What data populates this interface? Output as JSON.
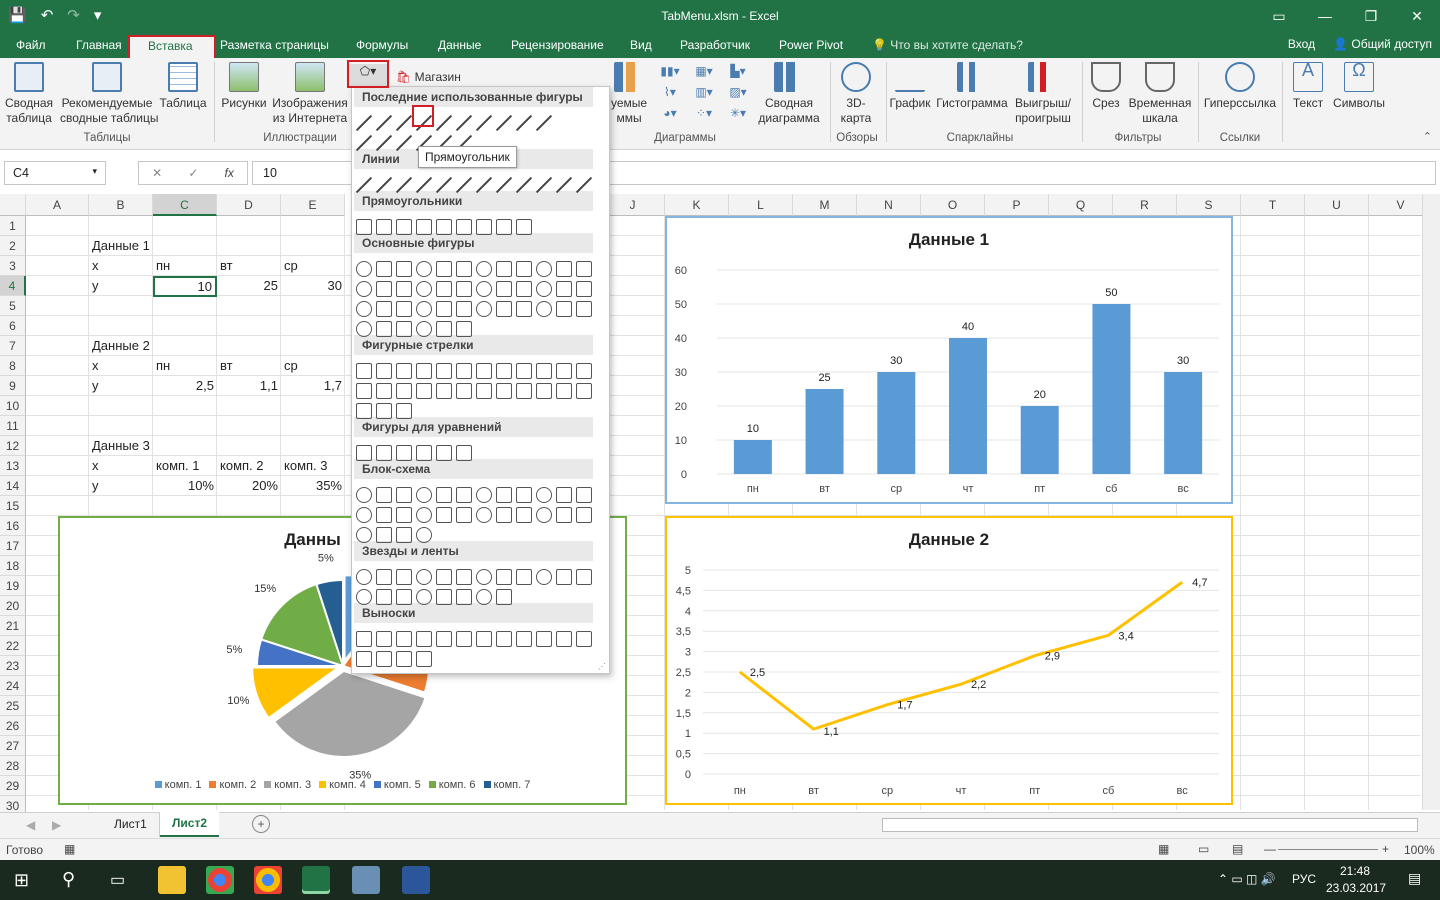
{
  "window": {
    "title": "TabMenu.xlsm - Excel",
    "controls": [
      "▭",
      "—",
      "❐",
      "✕"
    ]
  },
  "ribbon_tabs": [
    "Файл",
    "Главная",
    "Вставка",
    "Разметка страницы",
    "Формулы",
    "Данные",
    "Рецензирование",
    "Вид",
    "Разработчик",
    "Power Pivot"
  ],
  "active_tab": "Вставка",
  "tellme": "Что вы хотите сделать?",
  "login": "Вход",
  "share": "Общий доступ",
  "ribbon": {
    "pivot": "Сводная\nтаблица",
    "recommended_pivot": "Рекомендуемые\nсводные таблицы",
    "table": "Таблица",
    "pictures": "Рисунки",
    "online_pictures": "Изображения\nиз Интернета",
    "store": "Магазин",
    "recommended_charts_partial": "уемые\nммы",
    "pivot_chart": "Сводная\nдиаграмма",
    "map3d": "3D-\nкарта",
    "graph": "График",
    "histogram": "Гистограмма",
    "winloss": "Выигрыш/\nпроигрыш",
    "slicer": "Срез",
    "timeline": "Временная\nшкала",
    "hyperlink": "Гиперссылка",
    "text": "Текст",
    "symbols": "Символы",
    "groups": {
      "tables": "Таблицы",
      "illustrations": "Иллюстрации",
      "charts": "Диаграммы",
      "tours": "Обзоры",
      "sparklines": "Спарклайны",
      "filters": "Фильтры",
      "links": "Ссылки"
    }
  },
  "formula_bar": {
    "name_box": "C4",
    "value": "10"
  },
  "columns": [
    "A",
    "B",
    "C",
    "D",
    "E",
    "J",
    "K",
    "L",
    "M",
    "N",
    "O",
    "P",
    "Q",
    "R",
    "S",
    "T",
    "U",
    "V"
  ],
  "rows": [
    "1",
    "2",
    "3",
    "4",
    "5",
    "6",
    "7",
    "8",
    "9",
    "10",
    "11",
    "12",
    "13",
    "14",
    "15",
    "16",
    "17",
    "18",
    "19",
    "20",
    "21",
    "22",
    "23",
    "24",
    "25",
    "26",
    "27",
    "28",
    "29",
    "30"
  ],
  "cells": {
    "b2": "Данные 1",
    "b3": "x",
    "c3": "пн",
    "d3": "вт",
    "e3": "ср",
    "b4": "y",
    "c4": "10",
    "d4": "25",
    "e4": "30",
    "b7": "Данные 2",
    "b8": "x",
    "c8": "пн",
    "d8": "вт",
    "e8": "ср",
    "b9": "y",
    "c9": "2,5",
    "d9": "1,1",
    "e9": "1,7",
    "b12": "Данные 3",
    "b13": "x",
    "c13": "комп. 1",
    "d13": "комп. 2",
    "e13": "комп. 3",
    "b14": "y",
    "c14": "10%",
    "d14": "20%",
    "e14": "35%"
  },
  "shapes_menu": {
    "sections": [
      "Последние использованные фигуры",
      "Линии",
      "Прямоугольники",
      "Основные фигуры",
      "Фигурные стрелки",
      "Фигуры для уравнений",
      "Блок-схема",
      "Звезды и ленты",
      "Выноски"
    ],
    "tooltip": "Прямоугольник"
  },
  "chart_data": [
    {
      "type": "bar",
      "title": "Данные 1",
      "categories": [
        "пн",
        "вт",
        "ср",
        "чт",
        "пт",
        "сб",
        "вс"
      ],
      "values": [
        10,
        25,
        30,
        40,
        20,
        50,
        30
      ],
      "ylim": [
        0,
        60
      ],
      "yticks": [
        "0",
        "10",
        "20",
        "30",
        "40",
        "50",
        "60"
      ],
      "color": "#5b9bd5"
    },
    {
      "type": "line",
      "title": "Данные 2",
      "categories": [
        "пн",
        "вт",
        "ср",
        "чт",
        "пт",
        "сб",
        "вс"
      ],
      "values": [
        2.5,
        1.1,
        1.7,
        2.2,
        2.9,
        3.4,
        4.7
      ],
      "labels": [
        "2,5",
        "1,1",
        "1,7",
        "2,2",
        "2,9",
        "3,4",
        "4,7"
      ],
      "ylim": [
        0,
        5
      ],
      "yticks": [
        "0",
        "0,5",
        "1",
        "1,5",
        "2",
        "2,5",
        "3",
        "3,5",
        "4",
        "4,5",
        "5"
      ],
      "color": "#ffc000"
    },
    {
      "type": "pie",
      "title": "Данны",
      "categories": [
        "комп. 1",
        "комп. 2",
        "комп. 3",
        "комп. 4",
        "комп. 5",
        "комп. 6",
        "комп. 7"
      ],
      "values": [
        10,
        20,
        35,
        10,
        5,
        15,
        5
      ],
      "labels": [
        "",
        "",
        "35%",
        "10%",
        "5%",
        "15%",
        "5%"
      ],
      "colors": [
        "#5b9bd5",
        "#ed7d31",
        "#a5a5a5",
        "#ffc000",
        "#4472c4",
        "#70ad47",
        "#255e91"
      ]
    }
  ],
  "sheets": [
    "Лист1",
    "Лист2"
  ],
  "active_sheet": "Лист2",
  "status": {
    "ready": "Готово",
    "zoom": "100%"
  },
  "taskbar": {
    "lang": "РУС",
    "time": "21:48",
    "date": "23.03.2017"
  }
}
